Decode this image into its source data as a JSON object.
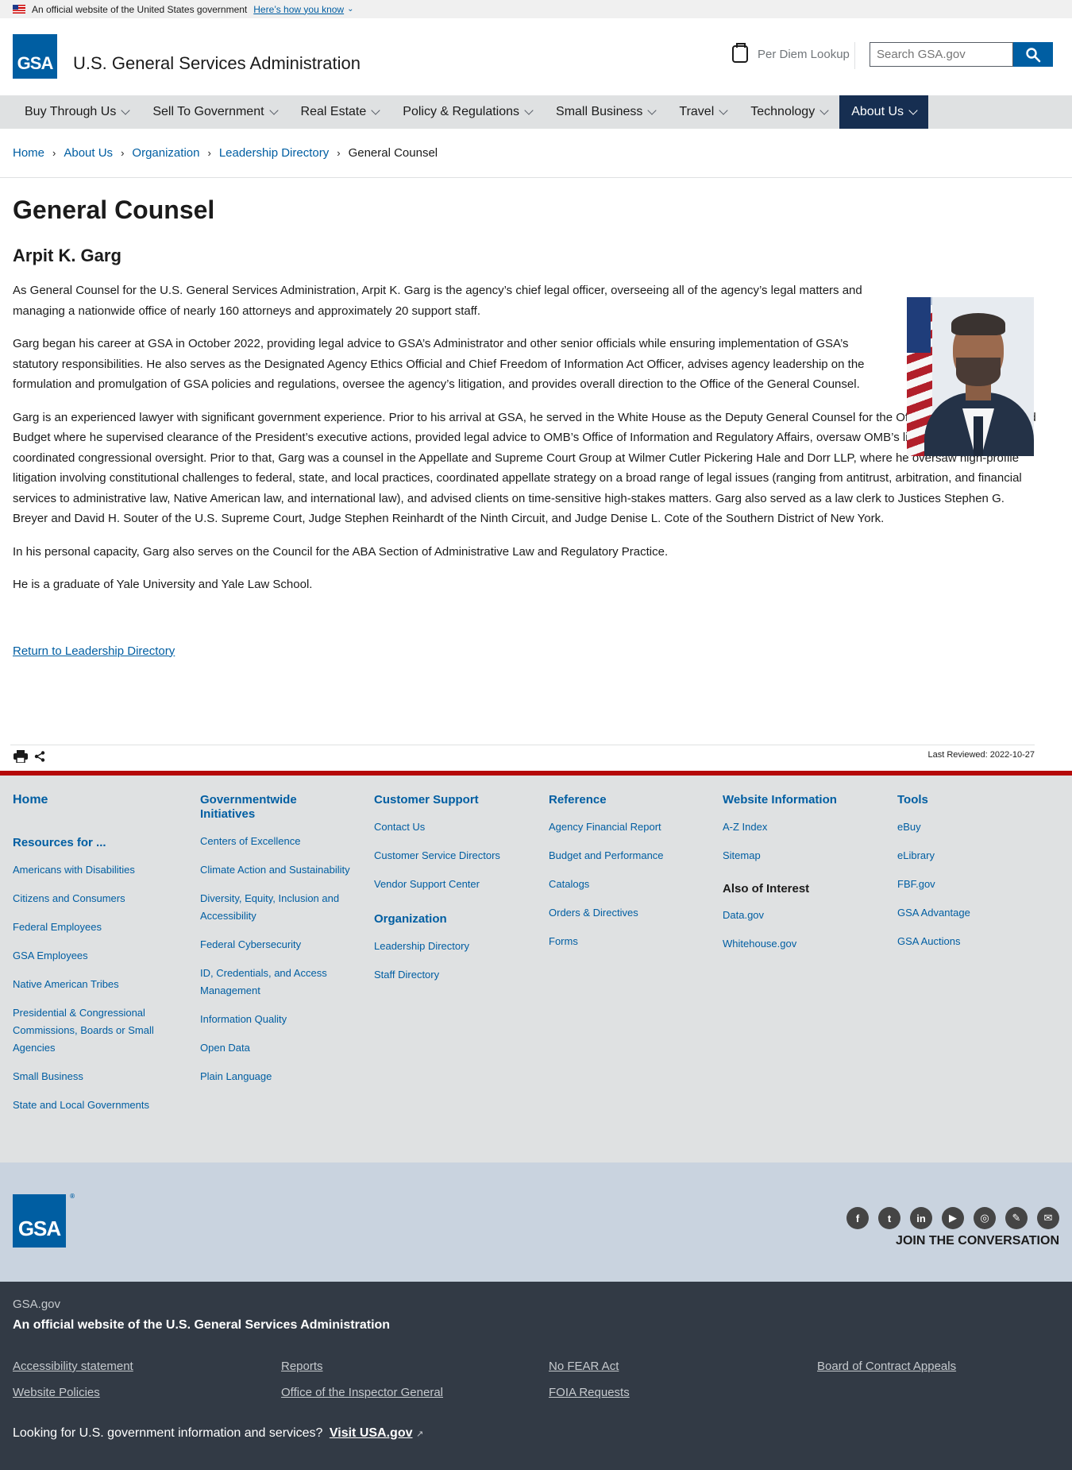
{
  "banner": {
    "text": "An official website of the United States government",
    "link": "Here’s how you know"
  },
  "header": {
    "logo_text": "GSA",
    "site_title": "U.S. General Services Administration",
    "per_diem": "Per Diem Lookup",
    "search_placeholder": "Search GSA.gov"
  },
  "nav": {
    "items": [
      {
        "label": "Buy Through Us",
        "active": false
      },
      {
        "label": "Sell To Government",
        "active": false
      },
      {
        "label": "Real Estate",
        "active": false
      },
      {
        "label": "Policy & Regulations",
        "active": false
      },
      {
        "label": "Small Business",
        "active": false
      },
      {
        "label": "Travel",
        "active": false
      },
      {
        "label": "Technology",
        "active": false
      },
      {
        "label": "About Us",
        "active": true
      }
    ]
  },
  "breadcrumb": [
    "Home",
    "About Us",
    "Organization",
    "Leadership Directory",
    "General Counsel"
  ],
  "page": {
    "title": "General Counsel",
    "name": "Arpit K. Garg",
    "paragraphs": [
      "As General Counsel for the U.S. General Services Administration, Arpit K. Garg is the agency’s chief legal officer, overseeing all of the agency’s legal matters and managing a nationwide office of nearly 160 attorneys and approximately 20 support staff.",
      "Garg began his career at GSA in October 2022, providing legal advice to GSA’s Administrator and other senior officials while ensuring implementation of GSA’s statutory responsibilities. He also serves as the Designated Agency Ethics Official and Chief Freedom of Information Act Officer, advises agency leadership on the formulation and promulgation of GSA policies and regulations, oversee the agency’s litigation, and provides overall direction to the Office of the General Counsel.",
      "Garg is an experienced lawyer with significant government experience. Prior to his arrival at GSA, he served in the White House as the Deputy General Counsel for the Office of Management and Budget where he supervised clearance of the President’s executive actions, provided legal advice to OMB’s Office of Information and Regulatory Affairs, oversaw OMB’s litigation, and coordinated congressional oversight. Prior to that, Garg was a counsel in the Appellate and Supreme Court Group at Wilmer Cutler Pickering Hale and Dorr LLP, where he oversaw high-profile litigation involving constitutional challenges to federal, state, and local practices, coordinated appellate strategy on a broad range of legal issues (ranging from antitrust, arbitration, and financial services to administrative law, Native American law, and international law), and advised clients on time-sensitive high-stakes matters. Garg also served as a law clerk to Justices Stephen G. Breyer and David H. Souter of the U.S. Supreme Court, Judge Stephen Reinhardt of the Ninth Circuit, and Judge Denise L. Cote of the Southern District of New York.",
      "In his personal capacity, Garg also serves on the Council for the ABA Section of Administrative Law and Regulatory Practice.",
      "He is a graduate of Yale University and Yale Law School."
    ],
    "return_link": "Return to Leadership Directory",
    "last_reviewed": "Last Reviewed: 2022-10-27"
  },
  "footer": {
    "home": "Home",
    "resources_head": "Resources for ...",
    "resources": [
      "Americans with Disabilities",
      "Citizens and Consumers",
      "Federal Employees",
      "GSA Employees",
      "Native American Tribes",
      "Presidential & Congressional Commissions, Boards or Small Agencies",
      "Small Business",
      "State and Local Governments"
    ],
    "initiatives_head": "Governmentwide Initiatives",
    "initiatives": [
      "Centers of Excellence",
      "Climate Action and Sustainability",
      "Diversity, Equity, Inclusion and Accessibility",
      "Federal Cybersecurity",
      "ID, Credentials, and Access Management",
      "Information Quality",
      "Open Data",
      "Plain Language"
    ],
    "support_head": "Customer Support",
    "support": [
      "Contact Us",
      "Customer Service Directors",
      "Vendor Support Center"
    ],
    "org_head": "Organization",
    "org": [
      "Leadership Directory",
      "Staff Directory"
    ],
    "reference_head": "Reference",
    "reference": [
      "Agency Financial Report",
      "Budget and Performance",
      "Catalogs",
      "Orders & Directives",
      "Forms"
    ],
    "website_head": "Website Information",
    "website": [
      "A-Z Index",
      "Sitemap"
    ],
    "interest_head": "Also of Interest",
    "interest": [
      "Data.gov",
      "Whitehouse.gov"
    ],
    "tools_head": "Tools",
    "tools": [
      "eBuy",
      "eLibrary",
      "FBF.gov",
      "GSA Advantage",
      "GSA Auctions"
    ]
  },
  "social": {
    "icons": [
      "facebook-icon",
      "twitter-icon",
      "linkedin-icon",
      "youtube-icon",
      "instagram-icon",
      "blog-icon",
      "email-icon"
    ],
    "join": "JOIN THE CONVERSATION"
  },
  "identifier": {
    "domain": "GSA.gov",
    "official": "An official website of the U.S. General Services Administration",
    "links": [
      "Accessibility statement",
      "Reports",
      "No FEAR Act",
      "Board of Contract Appeals",
      "Website Policies",
      "Office of the Inspector General",
      "FOIA Requests"
    ],
    "looking": "Looking for U.S. government information and services?",
    "visit": "Visit USA.gov"
  }
}
